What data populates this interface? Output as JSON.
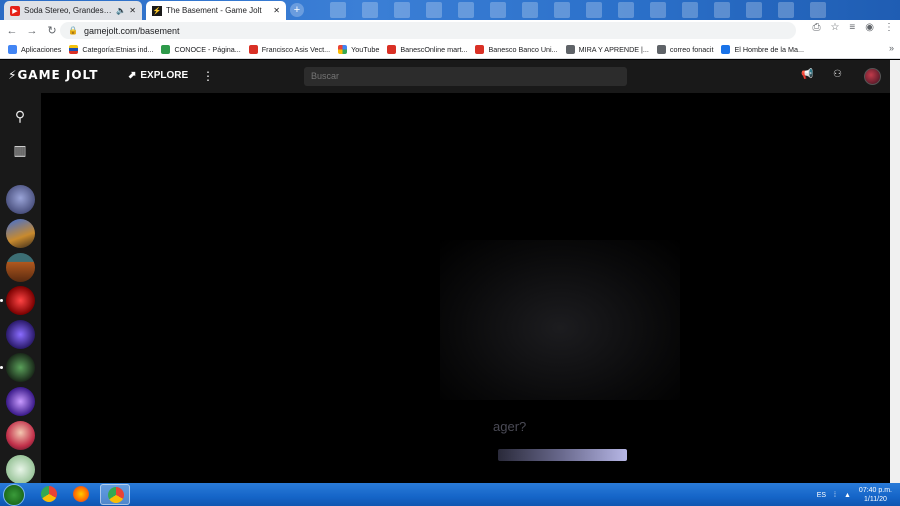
{
  "browser": {
    "tabs": [
      {
        "title": "Soda Stereo, Grandes Éxitos",
        "icon": "youtube-icon",
        "audio": "speaker-icon"
      },
      {
        "title": "The Basement - Game Jolt",
        "icon": "gamejolt-icon"
      }
    ],
    "new_tab_label": "+",
    "url": "gamejolt.com/basement",
    "bookmarks": [
      {
        "label": "Aplicaciones",
        "color": "#4285f4"
      },
      {
        "label": "Categoría:Etnias ind...",
        "color": "#f4c20d"
      },
      {
        "label": "CONOCE - Página...",
        "color": "#2e9a4a"
      },
      {
        "label": "Francisco Asis Vect...",
        "color": "#d93025"
      },
      {
        "label": "YouTube",
        "color": "#4285f4"
      },
      {
        "label": "BanescOnline mart...",
        "color": "#d93025"
      },
      {
        "label": "Banesco Banco Uni...",
        "color": "#d93025"
      },
      {
        "label": "MIRA Y APRENDE |...",
        "color": "#5f6368"
      },
      {
        "label": "correo fonacit",
        "color": "#5f6368"
      },
      {
        "label": "El Hombre de la Ma...",
        "color": "#1a73e8"
      }
    ],
    "bookmarks_more": "»"
  },
  "gamejolt": {
    "logo": "GAME JOLT",
    "explore_label": "EXPLORE",
    "search_placeholder": "Buscar"
  },
  "content": {
    "question_text": "ager?",
    "progress_fraction": 1.0
  },
  "taskbar": {
    "language": "ES",
    "time": "07:40 p.m.",
    "date": "1/11/20"
  }
}
